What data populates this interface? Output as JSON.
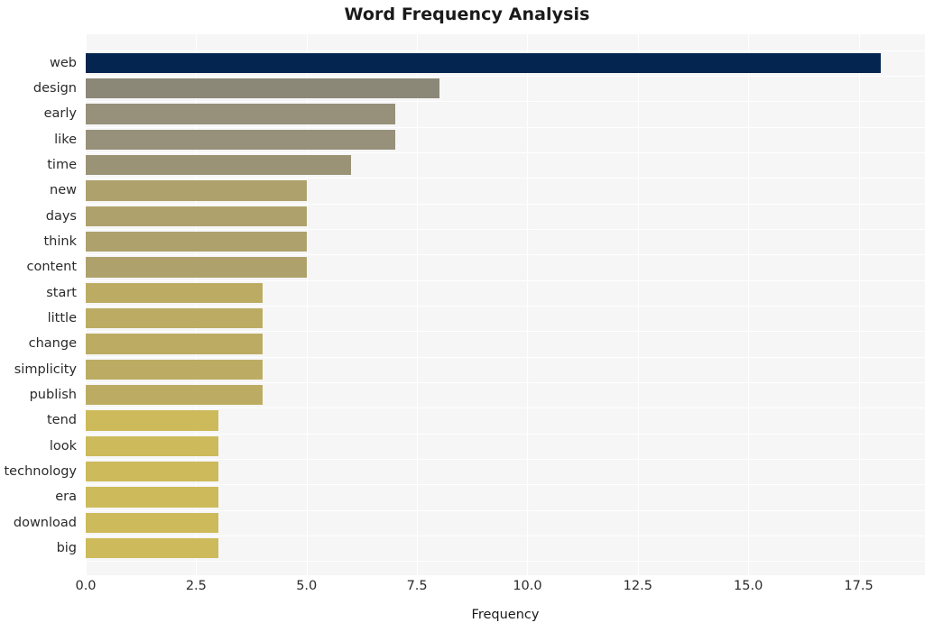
{
  "chart_data": {
    "type": "bar",
    "orientation": "horizontal",
    "title": "Word Frequency Analysis",
    "xlabel": "Frequency",
    "ylabel": "",
    "xlim": [
      0,
      19
    ],
    "xticks": [
      "0.0",
      "2.5",
      "5.0",
      "7.5",
      "10.0",
      "12.5",
      "15.0",
      "17.5"
    ],
    "xtick_values": [
      0,
      2.5,
      5,
      7.5,
      10,
      12.5,
      15,
      17.5
    ],
    "grid": "vertical-and-horizontal-white-on-light-panel",
    "legend": "none",
    "categories": [
      "web",
      "design",
      "early",
      "like",
      "time",
      "new",
      "days",
      "think",
      "content",
      "start",
      "little",
      "change",
      "simplicity",
      "publish",
      "tend",
      "look",
      "technology",
      "era",
      "download",
      "big"
    ],
    "values": [
      18,
      8,
      7,
      7,
      6,
      5,
      5,
      5,
      5,
      4,
      4,
      4,
      4,
      4,
      3,
      3,
      3,
      3,
      3,
      3
    ],
    "bar_colors": [
      "#04254f",
      "#8b8878",
      "#97907a",
      "#97907a",
      "#9b9375",
      "#aea16b",
      "#aea16b",
      "#aea16b",
      "#aea16b",
      "#bcac63",
      "#bcac63",
      "#bcac63",
      "#bcac63",
      "#bcac63",
      "#cdba5a",
      "#cdba5a",
      "#cdba5a",
      "#cdba5a",
      "#cdba5a",
      "#cdba5a"
    ],
    "plot_background": "#f6f6f7",
    "figure_background": "#ffffff",
    "title_color": "#1a1a1a",
    "tick_color": "#2b2b2b"
  }
}
